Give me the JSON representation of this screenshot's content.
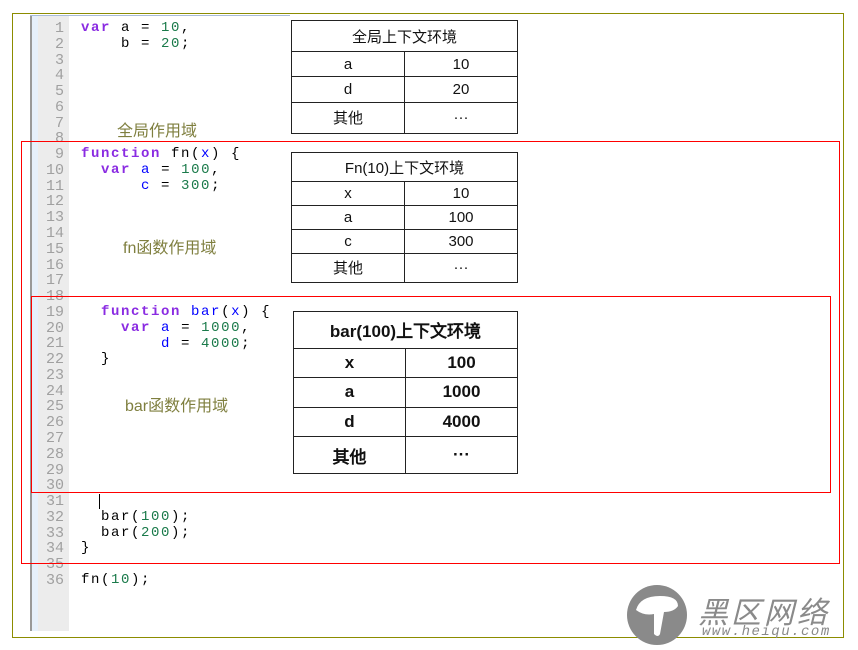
{
  "line_numbers": [
    "1",
    "2",
    "3",
    "4",
    "5",
    "6",
    "7",
    "8",
    "9",
    "10",
    "11",
    "12",
    "13",
    "14",
    "15",
    "16",
    "17",
    "18",
    "19",
    "20",
    "21",
    "22",
    "23",
    "24",
    "25",
    "26",
    "27",
    "28",
    "29",
    "30",
    "31",
    "32",
    "33",
    "34",
    "35",
    "36"
  ],
  "code": {
    "l1": {
      "kw": "var",
      "rest": " a = ",
      "num": "10",
      "end": ","
    },
    "l2": {
      "pre": "    b = ",
      "num": "20",
      "end": ";"
    },
    "l9": {
      "kw": "function",
      "rest": " fn(",
      "id": "x",
      "end": ") {"
    },
    "l10": {
      "kw": "var",
      "id": "a",
      "mid": " = ",
      "num": "100",
      "end": ","
    },
    "l11": {
      "id": "c",
      "mid": " = ",
      "num": "300",
      "end": ";"
    },
    "l19": {
      "kw": "function",
      "id": "bar",
      "p": "(",
      "id2": "x",
      "end": ") {"
    },
    "l20": {
      "kw": "var",
      "id": "a",
      "mid": " = ",
      "num": "1000",
      "end": ","
    },
    "l21": {
      "id": "d",
      "mid": " = ",
      "num": "4000",
      "end": ";"
    },
    "l22": "  }",
    "l32": {
      "pre": "  bar(",
      "num": "100",
      "end": ");"
    },
    "l33": {
      "pre": "  bar(",
      "num": "200",
      "end": ");"
    },
    "l34": "}",
    "l36": {
      "pre": "fn(",
      "num": "10",
      "end": ");"
    }
  },
  "scopes": {
    "global": "全局作用域",
    "fn": "fn函数作用域",
    "bar": "bar函数作用域"
  },
  "tables": {
    "global": {
      "title": "全局上下文环境",
      "rows": [
        [
          "a",
          "10"
        ],
        [
          "d",
          "20"
        ],
        [
          "其他",
          "···"
        ]
      ]
    },
    "fn": {
      "title": "Fn(10)上下文环境",
      "rows": [
        [
          "x",
          "10"
        ],
        [
          "a",
          "100"
        ],
        [
          "c",
          "300"
        ],
        [
          "其他",
          "···"
        ]
      ]
    },
    "bar": {
      "title": "bar(100)上下文环境",
      "rows": [
        [
          "x",
          "100"
        ],
        [
          "a",
          "1000"
        ],
        [
          "d",
          "4000"
        ],
        [
          "其他",
          "···"
        ]
      ]
    }
  },
  "watermark": {
    "name": "黑区网络",
    "url": "www.heiqu.com"
  },
  "colors": {
    "keyword": "#8a2be2",
    "identifier": "#0000ff",
    "number": "#1a7a4a",
    "scope_label": "#7f7f3f",
    "scope_box": "#ff0000",
    "frame": "#8c8c00"
  }
}
